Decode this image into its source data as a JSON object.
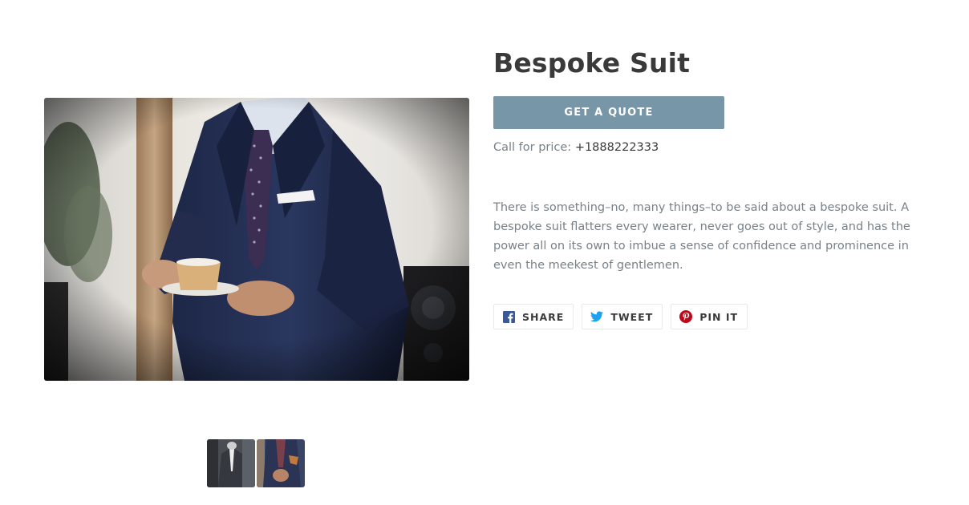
{
  "product": {
    "title": "Bespoke Suit",
    "quote_button_label": "GET A QUOTE",
    "price_prefix": "Call for price:",
    "phone": "+1888222333",
    "description": "There is something–no, many things–to be said about a bespoke suit. A bespoke suit flatters every wearer, never goes out of style, and has the power all on its own to imbue a sense of confidence and prominence in even the meekest of gentlemen."
  },
  "share": {
    "facebook_label": "SHARE",
    "twitter_label": "TWEET",
    "pinterest_label": "PIN IT",
    "facebook_icon": "facebook-icon",
    "twitter_icon": "twitter-icon",
    "pinterest_icon": "pinterest-icon"
  },
  "colors": {
    "accent": "#7796a8",
    "heading": "#3a3a3a",
    "body_text": "#788188",
    "facebook": "#3b5998",
    "twitter": "#1da1f2",
    "pinterest": "#bd081c"
  },
  "images": {
    "main": "man-in-navy-suit-holding-teacup",
    "thumbnails": [
      "suit-on-mannequin",
      "man-in-suit-closeup"
    ]
  }
}
